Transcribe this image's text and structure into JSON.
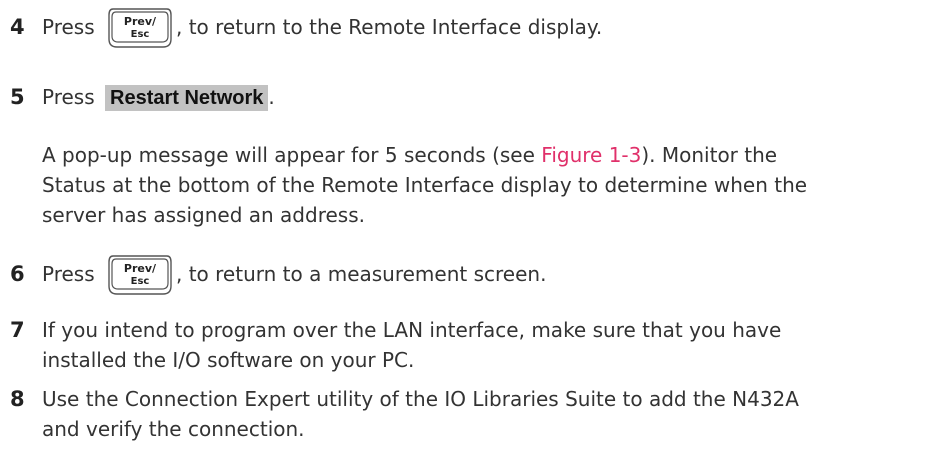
{
  "steps": {
    "s4": {
      "number": "4",
      "before": "Press",
      "key_line1": "Prev/",
      "key_line2": "Esc",
      "after": ", to return to the Remote Interface display."
    },
    "s5": {
      "number": "5",
      "before": "Press",
      "softkey": "Restart Network",
      "after": "."
    },
    "note": {
      "line1_before": "A pop-up message will appear for 5 seconds (see ",
      "link": "Figure 1-3",
      "line1_after": "). Monitor the",
      "line2": "Status at the bottom of the Remote Interface display to determine when the",
      "line3": "server has assigned an address."
    },
    "s6": {
      "number": "6",
      "before": "Press",
      "key_line1": "Prev/",
      "key_line2": "Esc",
      "after": ", to return to a measurement screen."
    },
    "s7": {
      "number": "7",
      "line1": "If you intend to program over the LAN interface, make sure that you have",
      "line2": "installed the I/O software on your PC."
    },
    "s8": {
      "number": "8",
      "line1": "Use the Connection Expert utility of the IO Libraries Suite to add the N432A",
      "line2": "and verify the connection."
    }
  },
  "colors": {
    "text": "#333333",
    "link": "#e0306a",
    "softkey_bg": "#c2c2c2"
  },
  "icons": {
    "key": "prev-esc-key-icon"
  }
}
